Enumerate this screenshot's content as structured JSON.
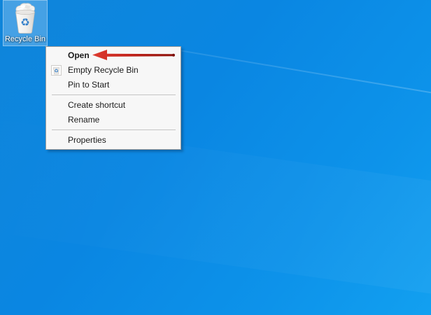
{
  "desktop": {
    "background_color": "#0b86e0",
    "icons": [
      {
        "label": "Recycle Bin",
        "icon": "recycle-bin-full-icon",
        "selected": true
      }
    ]
  },
  "context_menu": {
    "items": [
      {
        "label": "Open",
        "default": true
      },
      {
        "label": "Empty Recycle Bin",
        "icon": "empty-recycle-bin-icon"
      },
      {
        "label": "Pin to Start"
      },
      {
        "type": "separator"
      },
      {
        "label": "Create shortcut"
      },
      {
        "label": "Rename"
      },
      {
        "type": "separator"
      },
      {
        "label": "Properties"
      }
    ]
  },
  "annotation": {
    "type": "arrow",
    "color": "#c0221a",
    "points_to": "Open"
  },
  "colors": {
    "menu_background": "#f7f7f7",
    "menu_border": "#9b9b9b",
    "menu_text": "#1a1a1a",
    "separator": "#c4c4c4",
    "recycle_symbol_blue": "#2f7dc9",
    "selection_highlight": "rgba(200,228,252,0.30)"
  }
}
